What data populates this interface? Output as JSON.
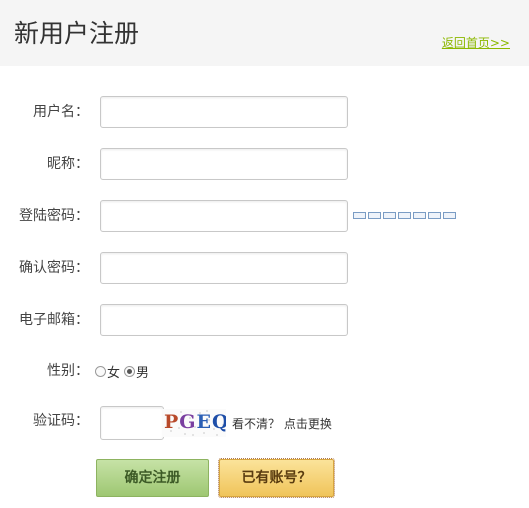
{
  "header": {
    "title": "新用户注册",
    "home_link": "返回首页>>"
  },
  "form": {
    "username_label": "用户名：",
    "nickname_label": "昵称：",
    "password_label": "登陆密码：",
    "confirm_label": "确认密码：",
    "email_label": "电子邮箱：",
    "gender_label": "性别：",
    "gender_options": [
      {
        "label": "女",
        "checked": false
      },
      {
        "label": "男",
        "checked": true
      }
    ],
    "captcha_label": "验证码：",
    "captcha_text": [
      "P",
      "G",
      "E",
      "Q"
    ],
    "refresh_text": "看不清？ 点击更换"
  },
  "buttons": {
    "register": "确定注册",
    "login": "已有账号？"
  },
  "colors": {
    "link": "#8cb800",
    "register_button": "#b3d58c",
    "login_button": "#f6d479"
  }
}
